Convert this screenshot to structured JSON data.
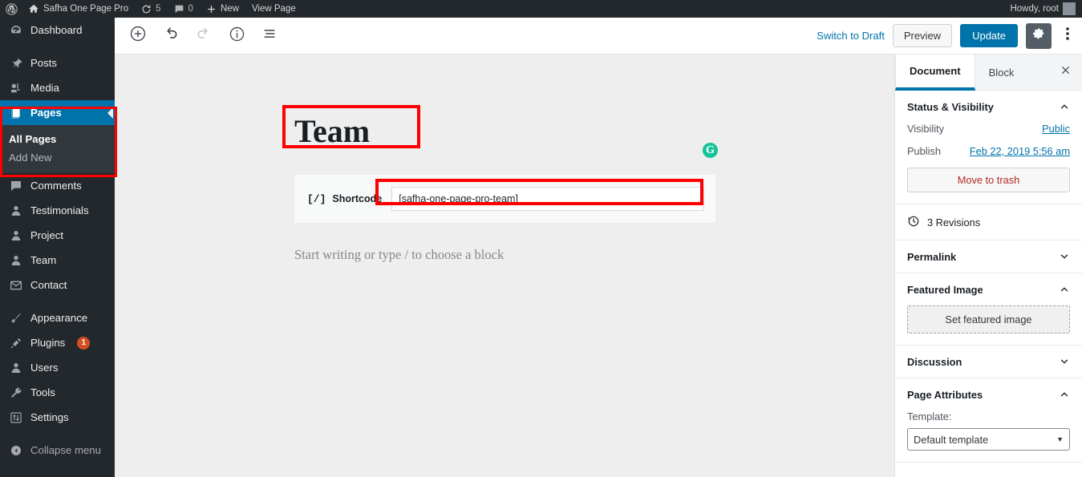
{
  "adminbar": {
    "logo_icon": "wordpress-logo-icon",
    "site_name": "Safha One Page Pro",
    "home_icon": "home-icon",
    "updates_icon": "updates-icon",
    "updates_count": "5",
    "comments_icon": "comments-icon",
    "comments_count": "0",
    "new_icon": "plus-icon",
    "new_label": "New",
    "view_page_label": "View Page",
    "howdy": "Howdy, root"
  },
  "sidebar": {
    "items": [
      {
        "label": "Dashboard",
        "icon": "dashboard-icon",
        "name": "dashboard"
      },
      {
        "label": "Posts",
        "icon": "pin-icon",
        "name": "posts"
      },
      {
        "label": "Media",
        "icon": "media-icon",
        "name": "media"
      },
      {
        "label": "Pages",
        "icon": "pages-icon",
        "name": "pages"
      },
      {
        "label": "Comments",
        "icon": "comment-icon",
        "name": "comments"
      },
      {
        "label": "Testimonials",
        "icon": "user-icon",
        "name": "testimonials"
      },
      {
        "label": "Project",
        "icon": "user-icon",
        "name": "project"
      },
      {
        "label": "Team",
        "icon": "user-icon",
        "name": "team"
      },
      {
        "label": "Contact",
        "icon": "envelope-icon",
        "name": "contact"
      },
      {
        "label": "Appearance",
        "icon": "brush-icon",
        "name": "appearance"
      },
      {
        "label": "Plugins",
        "icon": "plug-icon",
        "name": "plugins",
        "badge": "1"
      },
      {
        "label": "Users",
        "icon": "user-icon",
        "name": "users"
      },
      {
        "label": "Tools",
        "icon": "wrench-icon",
        "name": "tools"
      },
      {
        "label": "Settings",
        "icon": "settings-icon",
        "name": "settings"
      },
      {
        "label": "Collapse menu",
        "icon": "collapse-icon",
        "name": "collapse-menu"
      }
    ],
    "pages_submenu": [
      {
        "label": "All Pages",
        "name": "all-pages"
      },
      {
        "label": "Add New",
        "name": "add-new"
      }
    ],
    "accent_color": "#0073aa",
    "badge_color": "#d54e21"
  },
  "editor_header": {
    "add_block_icon": "plus-circle-icon",
    "undo_icon": "undo-icon",
    "redo_icon": "redo-icon",
    "info_icon": "info-icon",
    "block_navigation_icon": "list-view-icon",
    "switch_to_draft": "Switch to Draft",
    "preview": "Preview",
    "update": "Update",
    "settings_gear_icon": "gear-icon",
    "more_menu_icon": "kebab-menu-icon",
    "update_color": "#0073aa"
  },
  "canvas": {
    "post_title": "Team",
    "grammarly_icon": "grammarly-icon",
    "grammarly_letter": "G",
    "grammarly_color": "#15c39a",
    "shortcode_block": {
      "icon_glyph": "[/]",
      "icon_name": "shortcode-icon",
      "label": "Shortcode",
      "value": "[safha-one-page-pro-team]"
    },
    "default_appender": "Start writing or type / to choose a block",
    "annotation_color": "#ff0000"
  },
  "settings_panel": {
    "tabs": [
      {
        "label": "Document",
        "name": "document"
      },
      {
        "label": "Block",
        "name": "block"
      }
    ],
    "close_icon": "close-icon",
    "status_visibility": {
      "title": "Status & Visibility",
      "visibility_label": "Visibility",
      "visibility_value": "Public",
      "publish_label": "Publish",
      "publish_value": "Feb 22, 2019 5:56 am",
      "move_to_trash": "Move to trash"
    },
    "revisions": {
      "icon": "revision-clock-icon",
      "label": "3 Revisions"
    },
    "permalink": {
      "title": "Permalink"
    },
    "featured_image": {
      "title": "Featured Image",
      "button": "Set featured image"
    },
    "discussion": {
      "title": "Discussion"
    },
    "page_attributes": {
      "title": "Page Attributes",
      "template_label": "Template:",
      "template_value": "Default template"
    }
  }
}
